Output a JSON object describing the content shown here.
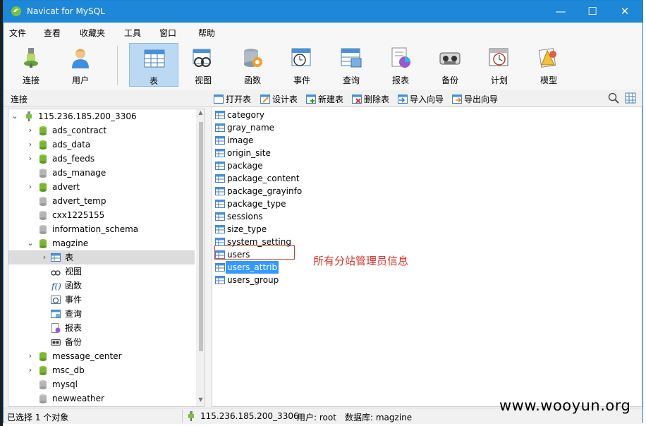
{
  "window": {
    "title": "Navicat for MySQL",
    "minimize": "—",
    "maximize": "☐",
    "close": "✕"
  },
  "menu": [
    "文件",
    "查看",
    "收藏夹",
    "工具",
    "窗口",
    "帮助"
  ],
  "toolbar": [
    {
      "label": "连接",
      "icon": "connection-icon"
    },
    {
      "label": "用户",
      "icon": "user-icon"
    },
    {
      "label": "表",
      "icon": "table-icon",
      "active": true
    },
    {
      "label": "视图",
      "icon": "view-icon"
    },
    {
      "label": "函数",
      "icon": "function-icon"
    },
    {
      "label": "事件",
      "icon": "event-icon"
    },
    {
      "label": "查询",
      "icon": "query-icon"
    },
    {
      "label": "报表",
      "icon": "report-icon"
    },
    {
      "label": "备份",
      "icon": "backup-icon"
    },
    {
      "label": "计划",
      "icon": "schedule-icon"
    },
    {
      "label": "模型",
      "icon": "model-icon"
    }
  ],
  "subbar": {
    "connection_label": "连接",
    "actions": [
      "打开表",
      "设计表",
      "新建表",
      "删除表",
      "导入向导",
      "导出向导"
    ]
  },
  "tree": {
    "root": "115.236.185.200_3306",
    "databases": [
      {
        "name": "ads_contract",
        "open": true,
        "expandable": true
      },
      {
        "name": "ads_data",
        "open": true,
        "expandable": true
      },
      {
        "name": "ads_feeds",
        "open": true,
        "expandable": true
      },
      {
        "name": "ads_manage",
        "open": false,
        "expandable": false
      },
      {
        "name": "advert",
        "open": true,
        "expandable": true
      },
      {
        "name": "advert_temp",
        "open": false,
        "expandable": false
      },
      {
        "name": "cxx1225155",
        "open": false,
        "expandable": false
      },
      {
        "name": "information_schema",
        "open": false,
        "expandable": false
      },
      {
        "name": "magzine",
        "open": true,
        "expandable": true,
        "expanded": true
      }
    ],
    "magzine_children": [
      {
        "name": "表",
        "icon": "table-icon",
        "selected": true
      },
      {
        "name": "视图",
        "icon": "view-icon"
      },
      {
        "name": "函数",
        "icon": "function-icon"
      },
      {
        "name": "事件",
        "icon": "event-icon"
      },
      {
        "name": "查询",
        "icon": "query-icon"
      },
      {
        "name": "报表",
        "icon": "report-icon"
      },
      {
        "name": "备份",
        "icon": "backup-icon"
      }
    ],
    "databases_after": [
      {
        "name": "message_center",
        "open": true,
        "expandable": true
      },
      {
        "name": "msc_db",
        "open": true,
        "expandable": true
      },
      {
        "name": "mysql",
        "open": false,
        "expandable": false
      },
      {
        "name": "newweather",
        "open": false,
        "expandable": false
      }
    ]
  },
  "tables": [
    "category",
    "gray_name",
    "image",
    "origin_site",
    "package",
    "package_content",
    "package_grayinfo",
    "package_type",
    "sessions",
    "size_type",
    "system_setting",
    "users",
    "users_attrib",
    "users_group"
  ],
  "selected_table": "users_attrib",
  "highlighted_table": "users",
  "annotation": "所有分站管理员信息",
  "status": {
    "selection": "已选择 1 个对象",
    "connection": "115.236.185.200_3306",
    "user": "用户: root",
    "database": "数据库: magzine"
  },
  "watermark": "www.wooyun.org",
  "colors": {
    "titlebar": "#1e87d7",
    "selection": "#3399ff",
    "annotation": "#d9352b",
    "active_tool": "#bcd9f3"
  }
}
